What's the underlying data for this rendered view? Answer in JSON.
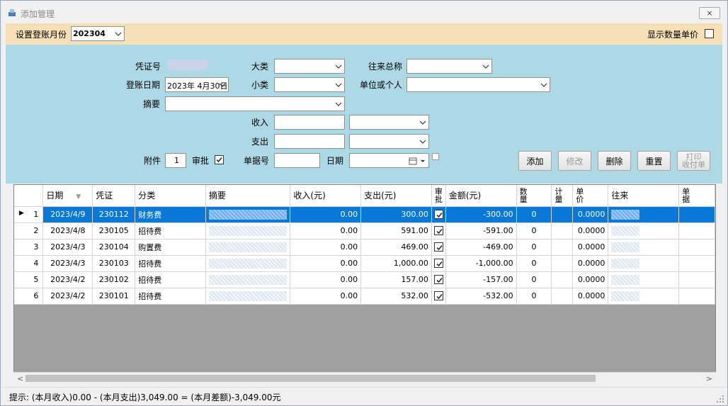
{
  "window": {
    "title": "添加管理",
    "close_label": "⨯"
  },
  "topbar": {
    "month_label": "设置登账月份",
    "month_value": "202304",
    "show_unit_price_label": "显示数量单价"
  },
  "form": {
    "voucher_no_label": "凭证号",
    "category_label": "大类",
    "partner_total_label": "往来总称",
    "post_date_label": "登账日期",
    "post_date_value": "2023年 4月30日",
    "subcategory_label": "小类",
    "unit_or_person_label": "单位或个人",
    "summary_label": "摘要",
    "income_label": "收入",
    "expense_label": "支出",
    "attachment_label": "附件",
    "attachment_value": "1",
    "approve_label": "审批",
    "doc_no_label": "单据号",
    "date_label": "日期"
  },
  "buttons": {
    "add": "添加",
    "modify": "修改",
    "delete": "删除",
    "reset": "重置",
    "print_line1": "打印",
    "print_line2": "收付单"
  },
  "grid": {
    "headers": {
      "date": "日期",
      "voucher": "凭证",
      "category": "分类",
      "summary": "摘要",
      "income": "收入(元)",
      "expense": "支出(元)",
      "approve_1": "审",
      "approve_2": "批",
      "amount": "金额(元)",
      "qty_1": "数",
      "qty_2": "量",
      "unit_1": "计",
      "unit_2": "量",
      "price_1": "单",
      "price_2": "价",
      "partner": "往来",
      "doc_1": "单",
      "doc_2": "据"
    },
    "rows": [
      {
        "no": "1",
        "date": "2023/4/9",
        "voucher": "230112",
        "category": "财务费",
        "income": "0.00",
        "expense": "300.00",
        "amount": "-300.00",
        "qty": "0",
        "price": "0.0000"
      },
      {
        "no": "2",
        "date": "2023/4/8",
        "voucher": "230105",
        "category": "招待费",
        "income": "0.00",
        "expense": "591.00",
        "amount": "-591.00",
        "qty": "0",
        "price": "0.0000"
      },
      {
        "no": "3",
        "date": "2023/4/3",
        "voucher": "230104",
        "category": "购置费",
        "income": "0.00",
        "expense": "469.00",
        "amount": "-469.00",
        "qty": "0",
        "price": "0.0000"
      },
      {
        "no": "4",
        "date": "2023/4/3",
        "voucher": "230103",
        "category": "招待费",
        "income": "0.00",
        "expense": "1,000.00",
        "amount": "-1,000.00",
        "qty": "0",
        "price": "0.0000"
      },
      {
        "no": "5",
        "date": "2023/4/2",
        "voucher": "230102",
        "category": "招待费",
        "income": "0.00",
        "expense": "157.00",
        "amount": "-157.00",
        "qty": "0",
        "price": "0.0000"
      },
      {
        "no": "6",
        "date": "2023/4/2",
        "voucher": "230101",
        "category": "招待费",
        "income": "0.00",
        "expense": "532.00",
        "amount": "-532.00",
        "qty": "0",
        "price": "0.0000"
      }
    ]
  },
  "status": {
    "text": "提示:    (本月收入)0.00 - (本月支出)3,049.00 = (本月差额)-3,049.00元"
  },
  "colors": {
    "topbar_bg": "#f7dfb6",
    "form_bg": "#add8e6",
    "selected_row": "#0a78d7"
  }
}
